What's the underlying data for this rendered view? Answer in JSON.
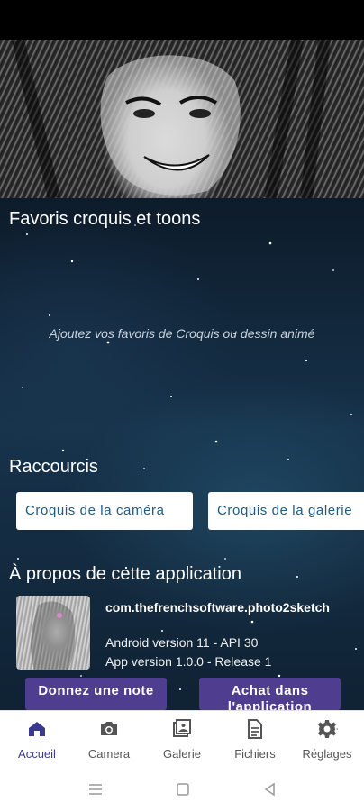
{
  "sections": {
    "favorites_title": "Favoris croquis et toons",
    "favorites_empty": "Ajoutez vos favoris de Croquis ou dessin animé",
    "shortcuts_title": "Raccourcis",
    "about_title": "À propos de cette application"
  },
  "shortcuts": [
    {
      "label": "Croquis de la caméra"
    },
    {
      "label": "Croquis de la galerie"
    }
  ],
  "about": {
    "package": "com.thefrenchsoftware.photo2sketch",
    "android_version": "Android version 11 - API 30",
    "app_version": "App version 1.0.0 - Release 1"
  },
  "actions": {
    "donate_label": "Donnez une note",
    "purchase_label": "Achat dans l'application"
  },
  "bottom_nav": {
    "items": [
      {
        "label": "Accueil",
        "icon": "home-icon",
        "active": true
      },
      {
        "label": "Camera",
        "icon": "camera-icon"
      },
      {
        "label": "Galerie",
        "icon": "gallery-icon"
      },
      {
        "label": "Fichiers",
        "icon": "file-icon"
      },
      {
        "label": "Réglages",
        "icon": "gear-icon"
      }
    ]
  },
  "colors": {
    "accent": "#3b3a8f",
    "button_bg": "#4f3d8f",
    "shortcut_text": "#1f5b82"
  }
}
